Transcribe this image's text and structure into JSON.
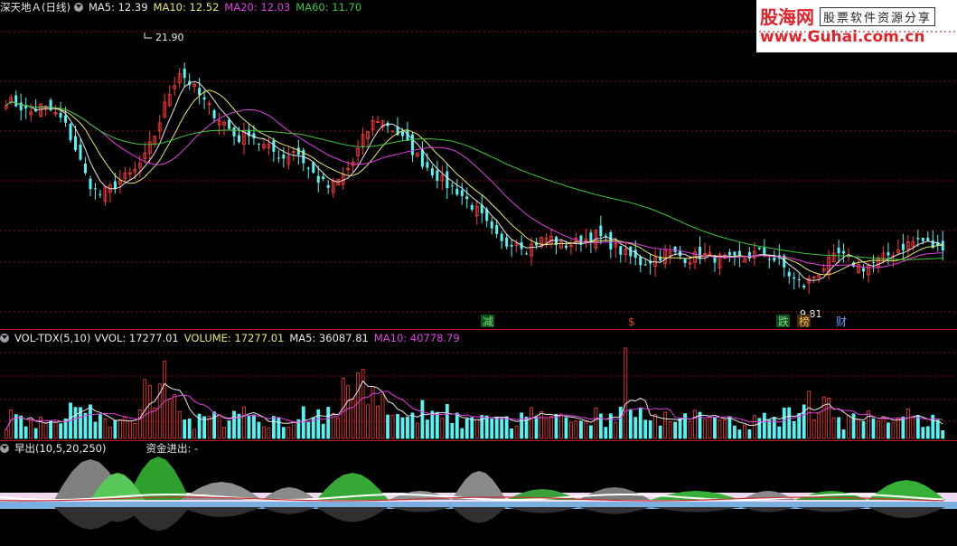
{
  "main_header": {
    "title": "深天地Ａ(日线)",
    "ma5": "MA5: 12.39",
    "ma10": "MA10: 12.52",
    "ma20": "MA20: 12.03",
    "ma60": "MA60: 11.70"
  },
  "vol_header": {
    "title": "VOL-TDX(5,10)",
    "vvol": "VVOL: 17277.01",
    "volume": "VOLUME: 17277.01",
    "ma5": "MA5: 36087.81",
    "ma10": "MA10: 40778.79"
  },
  "ind_header": {
    "title": "早出(10,5,20,250)",
    "capital_flow": "资金进出: -"
  },
  "annotations": {
    "high": "21.90",
    "low": "9.81",
    "marker_jian": "减",
    "marker_dollar": "$",
    "marker_die": "跌",
    "marker_bang": "榜",
    "marker_cai": "财"
  },
  "watermark": {
    "line1": "股海网",
    "line2": "股票软件资源分享",
    "line3": "www.Guhai.com.cn"
  },
  "colors": {
    "up": "#ff3c3c",
    "down": "#54f4f4",
    "ma5": "#e8e8e8",
    "ma10": "#e8e86a",
    "ma20": "#e040e0",
    "ma60": "#3cc83c",
    "grid": "#8a1010"
  },
  "chart_data": {
    "type": "line",
    "title": "深天地Ａ(日线)",
    "series": [
      {
        "name": "MA5",
        "last": 12.39
      },
      {
        "name": "MA10",
        "last": 12.52
      },
      {
        "name": "MA20",
        "last": 12.03
      },
      {
        "name": "MA60",
        "last": 11.7
      }
    ],
    "price_high": 21.9,
    "price_low": 9.81,
    "ylim": [
      9.0,
      23.0
    ],
    "close_path": [
      19.2,
      19.0,
      18.6,
      18.9,
      18.7,
      18.2,
      17.0,
      15.6,
      14.9,
      15.2,
      15.6,
      15.9,
      16.6,
      17.8,
      19.4,
      20.5,
      19.9,
      19.2,
      18.6,
      18.1,
      17.4,
      17.8,
      17.2,
      16.9,
      16.6,
      17.0,
      16.2,
      15.6,
      15.2,
      15.7,
      16.4,
      17.6,
      18.4,
      18.1,
      17.6,
      17.0,
      16.4,
      15.9,
      15.4,
      15.1,
      14.6,
      14.0,
      13.2,
      12.6,
      12.9,
      12.5,
      12.8,
      13.0,
      12.6,
      12.7,
      12.9,
      13.1,
      12.8,
      12.4,
      12.1,
      11.8,
      12.0,
      12.3,
      12.2,
      12.0,
      12.2,
      12.1,
      12.0,
      11.9,
      12.1,
      12.3,
      12.1,
      11.8,
      11.1,
      10.8,
      11.3,
      11.8,
      12.2,
      11.9,
      11.6,
      11.8,
      12.1,
      12.4,
      12.7,
      12.9,
      12.6,
      12.4
    ],
    "volume_ma5_last": 36087.81,
    "volume_ma10_last": 40778.79,
    "volume_last": 17277.01
  }
}
